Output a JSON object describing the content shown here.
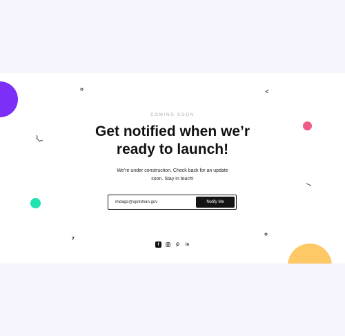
{
  "hero": {
    "eyebrow": "COMING SOON",
    "title_line1": "Get notified when we’r",
    "title_line2": "ready to launch!",
    "subtitle_line1": "We’re under construction. Check back for an update",
    "subtitle_line2": "soon. Stay in touch!"
  },
  "form": {
    "email_value": "ihidago@ujufidnan.gov",
    "email_placeholder": "",
    "button_label": "Notify Me"
  },
  "social": {
    "items": [
      {
        "icon": "facebook-icon",
        "glyph": "f"
      },
      {
        "icon": "instagram-icon",
        "glyph": ""
      },
      {
        "icon": "pinterest-icon",
        "glyph": ""
      },
      {
        "icon": "linkedin-icon",
        "glyph": "in"
      }
    ]
  },
  "colors": {
    "page_background": "#f6f4fc",
    "panel_background": "#ffffff",
    "accent_purple": "#7b2ff7",
    "accent_pink": "#ef5a87",
    "accent_green": "#1fe3b0",
    "accent_yellow": "#fdc865",
    "button_background": "#141414"
  }
}
